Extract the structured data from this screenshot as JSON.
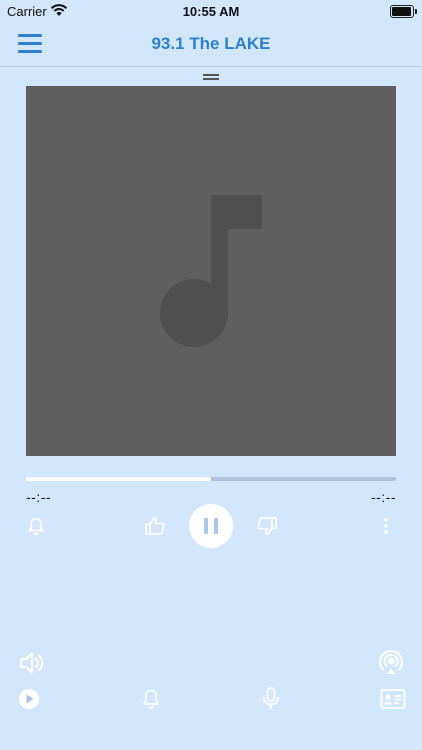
{
  "status": {
    "carrier": "Carrier",
    "time": "10:55 AM"
  },
  "nav": {
    "title": "93.1 The LAKE"
  },
  "player": {
    "progress_fraction": 0.5,
    "elapsed": "--:--",
    "remaining": "--:--"
  },
  "colors": {
    "background": "#d2e6fc",
    "accent": "#2f7fd1",
    "artwork": "#5f5f5f",
    "icon": "#ffffff"
  },
  "icons": {
    "controls": [
      "alarm-icon",
      "thumbs-up-icon",
      "pause-icon",
      "thumbs-down-icon",
      "more-icon"
    ],
    "bottom": [
      "volume-icon",
      "airplay-icon",
      "play-circle-icon",
      "alarm-icon",
      "microphone-icon",
      "contact-card-icon"
    ]
  }
}
